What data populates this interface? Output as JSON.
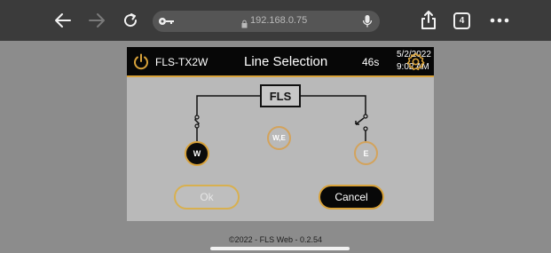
{
  "browser": {
    "url": "192.168.0.75",
    "tab_count": "4",
    "icons": [
      "back-arrow-icon",
      "forward-arrow-icon",
      "reload-icon",
      "key-icon",
      "lock-icon",
      "microphone-icon",
      "share-icon",
      "tabs-icon",
      "more-icon"
    ]
  },
  "app": {
    "device_name": "FLS-TX2W",
    "screen_title": "Line Selection",
    "timer": "46s",
    "date": "5/2/2022",
    "time": "9:02 AM",
    "accent_color": "#d8a23a",
    "header_icons": [
      "power-icon",
      "settings-gear-icon"
    ]
  },
  "diagram": {
    "box_label": "FLS",
    "options": [
      {
        "label": "W",
        "selected": true
      },
      {
        "label": "W,E",
        "selected": false
      },
      {
        "label": "E",
        "selected": false
      }
    ]
  },
  "buttons": {
    "ok": "Ok",
    "cancel": "Cancel"
  },
  "footer": {
    "text": "©2022 - FLS Web - 0.2.54"
  }
}
